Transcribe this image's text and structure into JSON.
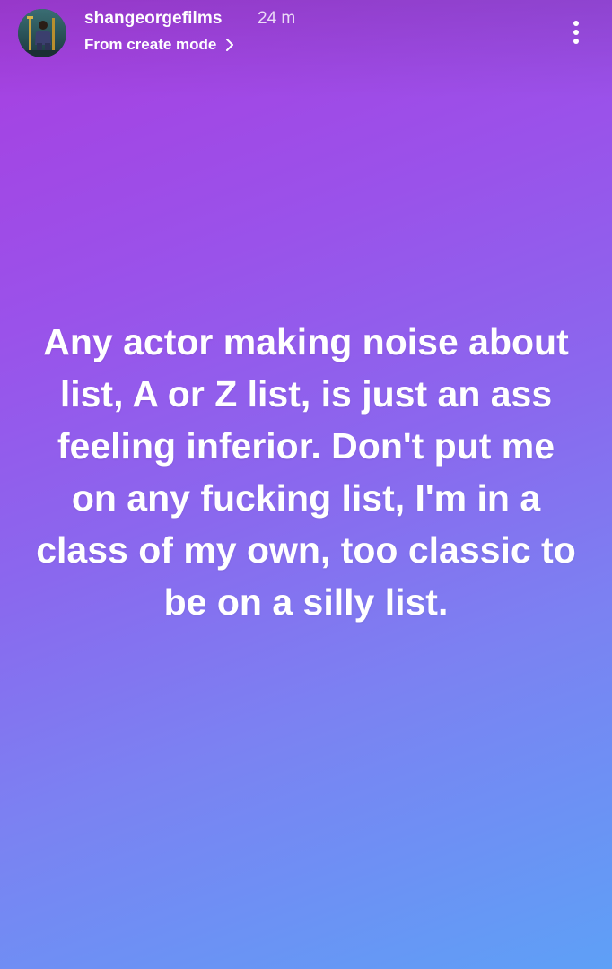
{
  "story": {
    "username": "shangeorgefilms",
    "timestamp": "24 m",
    "create_mode_label": "From create mode",
    "text": "Any actor making noise about list, A or Z list, is just an ass feeling inferior. Don't put me on any fucking list, I'm in a class of my own, too classic to be on a silly list."
  },
  "icons": {
    "avatar": "profile-avatar",
    "chevron": "chevron-right-icon",
    "more": "more-vertical-icon"
  },
  "colors": {
    "gradient_top": "#a83ee0",
    "gradient_middle": "#8a68ee",
    "gradient_bottom": "#5ea0f6",
    "text": "#ffffff"
  }
}
